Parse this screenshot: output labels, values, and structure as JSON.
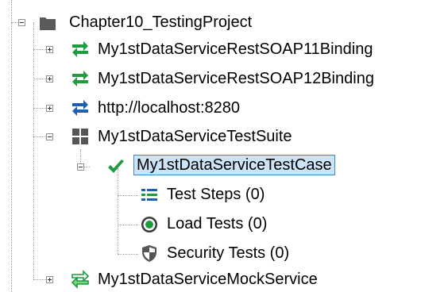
{
  "tree": {
    "root": {
      "label": "Chapter10_TestingProject",
      "icon": "folder-icon",
      "expanded": true
    },
    "items": [
      {
        "label": "My1stDataServiceRestSOAP11Binding",
        "icon": "interface-swap-icon",
        "expanded": false
      },
      {
        "label": "My1stDataServiceRestSOAP12Binding",
        "icon": "interface-swap-icon",
        "expanded": false
      },
      {
        "label": "http://localhost:8280",
        "icon": "rest-swap-icon",
        "expanded": false
      },
      {
        "label": "My1stDataServiceTestSuite",
        "icon": "testsuite-grid-icon",
        "expanded": true
      },
      {
        "label": "My1stDataServiceTestCase",
        "icon": "checkmark-icon",
        "expanded": true,
        "selected": true
      },
      {
        "label": "Test Steps (0)",
        "icon": "list-icon"
      },
      {
        "label": "Load Tests (0)",
        "icon": "gauge-icon"
      },
      {
        "label": "Security Tests (0)",
        "icon": "shield-icon"
      },
      {
        "label": "My1stDataServiceMockService",
        "icon": "mock-swap-icon",
        "expanded": false
      }
    ]
  },
  "colors": {
    "green": "#1e9c3f",
    "blue": "#1f5fb0",
    "selection_bg": "#cce4f7",
    "selection_border": "#3b86d1",
    "folder": "#5a5a5a"
  }
}
